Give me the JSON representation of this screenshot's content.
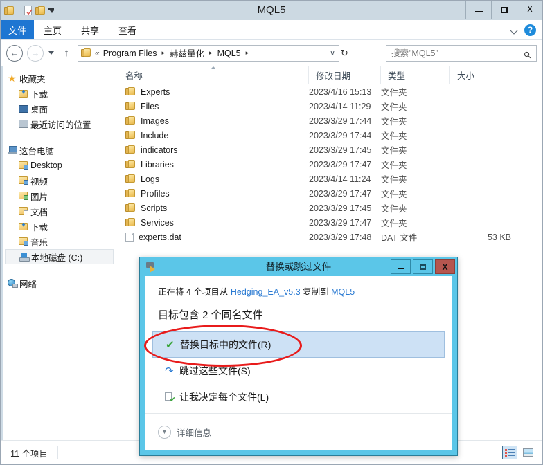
{
  "window": {
    "title": "MQL5",
    "minimize_label": "–",
    "maximize_label": "□",
    "close_label": "X"
  },
  "quick_access": {
    "folder_icon": "folder-icon",
    "properties_icon": "properties-icon",
    "new_folder_icon": "new-folder-icon",
    "customize_icon": "chevron-down-icon"
  },
  "ribbon": {
    "file_tab": "文件",
    "tabs": [
      "主页",
      "共享",
      "查看"
    ],
    "collapse_icon": "chevron-up-icon",
    "help_label": "?"
  },
  "address_bar": {
    "back_label": "←",
    "forward_label": "→",
    "recent_caret": "▾",
    "up_label": "↑",
    "root_sep": "«",
    "crumbs": [
      "Program Files",
      "赫兹量化",
      "MQL5"
    ],
    "crumb_arrow": "▸",
    "dropdown_label": "∨",
    "refresh_label": "↻",
    "search_placeholder": "搜索\"MQL5\"",
    "search_value": "",
    "search_icon": "search-icon"
  },
  "nav_pane": {
    "groups": [
      {
        "header": {
          "label": "收藏夹",
          "icon": "star-icon"
        },
        "items": [
          {
            "label": "下载",
            "icon": "downloads-folder-icon"
          },
          {
            "label": "桌面",
            "icon": "desktop-icon"
          },
          {
            "label": "最近访问的位置",
            "icon": "recent-places-icon"
          }
        ]
      },
      {
        "header": {
          "label": "这台电脑",
          "icon": "this-pc-icon"
        },
        "items": [
          {
            "label": "Desktop",
            "icon": "desktop-folder-icon"
          },
          {
            "label": "视频",
            "icon": "videos-folder-icon"
          },
          {
            "label": "图片",
            "icon": "pictures-folder-icon"
          },
          {
            "label": "文档",
            "icon": "documents-folder-icon"
          },
          {
            "label": "下载",
            "icon": "downloads-folder-icon"
          },
          {
            "label": "音乐",
            "icon": "music-folder-icon"
          },
          {
            "label": "本地磁盘 (C:)",
            "icon": "local-disk-icon",
            "selected": true
          }
        ]
      },
      {
        "header": {
          "label": "网络",
          "icon": "network-icon"
        },
        "items": []
      }
    ]
  },
  "file_list": {
    "columns": [
      "名称",
      "修改日期",
      "类型",
      "大小"
    ],
    "sort_column": "名称",
    "sort_direction": "asc",
    "rows": [
      {
        "name": "Experts",
        "date": "2023/4/16 15:13",
        "type": "文件夹",
        "size": "",
        "icon": "folder-icon"
      },
      {
        "name": "Files",
        "date": "2023/4/14 11:29",
        "type": "文件夹",
        "size": "",
        "icon": "folder-icon"
      },
      {
        "name": "Images",
        "date": "2023/3/29 17:44",
        "type": "文件夹",
        "size": "",
        "icon": "folder-icon"
      },
      {
        "name": "Include",
        "date": "2023/3/29 17:44",
        "type": "文件夹",
        "size": "",
        "icon": "folder-icon"
      },
      {
        "name": "indicators",
        "date": "2023/3/29 17:45",
        "type": "文件夹",
        "size": "",
        "icon": "folder-icon"
      },
      {
        "name": "Libraries",
        "date": "2023/3/29 17:47",
        "type": "文件夹",
        "size": "",
        "icon": "folder-icon"
      },
      {
        "name": "Logs",
        "date": "2023/4/14 11:24",
        "type": "文件夹",
        "size": "",
        "icon": "folder-icon"
      },
      {
        "name": "Profiles",
        "date": "2023/3/29 17:47",
        "type": "文件夹",
        "size": "",
        "icon": "folder-icon"
      },
      {
        "name": "Scripts",
        "date": "2023/3/29 17:45",
        "type": "文件夹",
        "size": "",
        "icon": "folder-icon"
      },
      {
        "name": "Services",
        "date": "2023/3/29 17:47",
        "type": "文件夹",
        "size": "",
        "icon": "folder-icon"
      },
      {
        "name": "experts.dat",
        "date": "2023/3/29 17:48",
        "type": "DAT 文件",
        "size": "53 KB",
        "icon": "file-icon"
      }
    ]
  },
  "status_bar": {
    "item_count": "11 个项目",
    "details_view_icon": "details-view-icon",
    "thumbnail_view_icon": "thumbnail-view-icon"
  },
  "dialog": {
    "title": "替换或跳过文件",
    "icon": "copy-files-icon",
    "minimize_label": "–",
    "maximize_label": "□",
    "close_label": "X",
    "line1_prefix": "正在将 4 个项目从 ",
    "line1_source": "Hedging_EA_v5.3",
    "line1_middle": " 复制到 ",
    "line1_target": "MQL5",
    "line2": "目标包含 2 个同名文件",
    "options": [
      {
        "label": "替换目标中的文件(R)",
        "icon": "green-check-icon",
        "selected": true
      },
      {
        "label": "跳过这些文件(S)",
        "icon": "skip-arrow-icon",
        "selected": false
      },
      {
        "label": "让我决定每个文件(L)",
        "icon": "decide-each-icon",
        "selected": false
      }
    ],
    "details_label": "详细信息",
    "details_icon": "chevron-down-circle-icon"
  },
  "annotation": {
    "shape": "ellipse",
    "color": "#e81b1b",
    "target": "替换目标中的文件(R)"
  },
  "colors": {
    "titlebar_bg": "#ccd9e2",
    "file_tab_bg": "#1e76d2",
    "dialog_frame": "#5bc6e8",
    "dialog_close_bg": "#b5564f",
    "selection_bg": "#cde1f5",
    "link": "#2a7ad2",
    "annotation_red": "#e81b1b"
  }
}
